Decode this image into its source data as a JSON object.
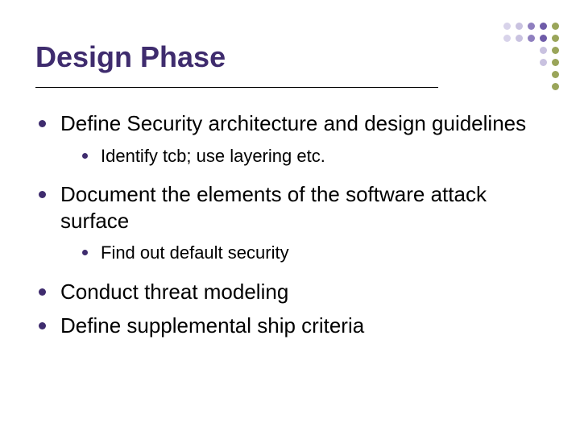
{
  "title": "Design Phase",
  "bullets": {
    "b0": "Define Security architecture and design guidelines",
    "b0s0": "Identify tcb; use layering etc.",
    "b1": "Document the elements of the software attack surface",
    "b1s0": "Find out default security",
    "b2": "Conduct threat modeling",
    "b3": "Define supplemental ship criteria"
  },
  "deco_colors": {
    "purple": "#6e5ba8",
    "olive": "#9aa55a",
    "lav": "#c9c2e0",
    "mid": "#8f7fbf",
    "light": "#d8d3ea"
  }
}
